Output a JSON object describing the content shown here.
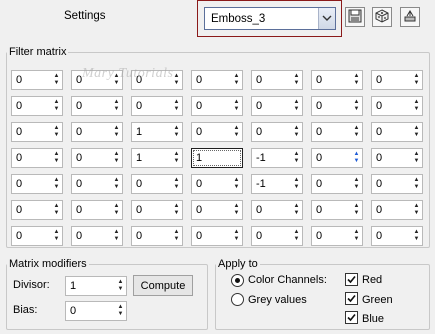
{
  "header": {
    "settings_label": "Settings",
    "preset_value": "Emboss_3",
    "buttons": [
      "save-icon",
      "dice-icon",
      "reset-icon"
    ]
  },
  "filter_matrix": {
    "title": "Filter matrix",
    "watermark": "Mary Tutorials",
    "rows": [
      [
        "0",
        "0",
        "0",
        "0",
        "0",
        "0",
        "0"
      ],
      [
        "0",
        "0",
        "0",
        "0",
        "0",
        "0",
        "0"
      ],
      [
        "0",
        "0",
        "1",
        "0",
        "0",
        "0",
        "0"
      ],
      [
        "0",
        "0",
        "1",
        "1",
        "-1",
        "0",
        "0"
      ],
      [
        "0",
        "0",
        "0",
        "0",
        "-1",
        "0",
        "0"
      ],
      [
        "0",
        "0",
        "0",
        "0",
        "0",
        "0",
        "0"
      ],
      [
        "0",
        "0",
        "0",
        "0",
        "0",
        "0",
        "0"
      ]
    ]
  },
  "matrix_modifiers": {
    "title": "Matrix modifiers",
    "divisor_label": "Divisor:",
    "divisor_value": "1",
    "bias_label": "Bias:",
    "bias_value": "0",
    "compute_label": "Compute"
  },
  "apply_to": {
    "title": "Apply to",
    "color_channels_label": "Color Channels:",
    "grey_values_label": "Grey values",
    "selected": "color_channels",
    "red_label": "Red",
    "green_label": "Green",
    "blue_label": "Blue",
    "red": true,
    "green": true,
    "blue": true
  }
}
